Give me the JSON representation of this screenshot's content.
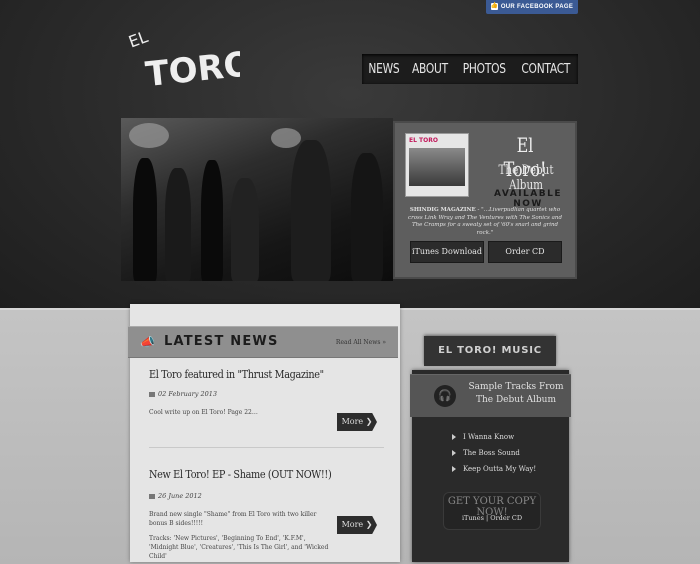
{
  "facebook": {
    "label": "OUR FACEBOOK PAGE"
  },
  "logo": {
    "text_el": "EL",
    "text_main": "TORO!"
  },
  "nav": {
    "items": [
      "NEWS",
      "ABOUT",
      "PHOTOS",
      "CONTACT"
    ]
  },
  "album": {
    "cover_title": "EL TORO",
    "title": "El Toro!",
    "subtitle": "The Debut Album",
    "availability": "AVAILABLE NOW",
    "blurb_source": "SHINDIG MAGAZINE",
    "blurb": "- \"…Liverpudlian quartet who cross Link Wray and The Ventures with The Sonics and The Cramps for a sweaty set of '60's snarl and grind rock.\"",
    "itunes_label": "iTunes Download",
    "order_label": "Order CD"
  },
  "news": {
    "header": "LATEST NEWS",
    "read_all": "Read All News »",
    "posts": [
      {
        "title": "El Toro featured in \"Thrust Magazine\"",
        "date": "02 February 2013",
        "body": "Cool write up on El Toro! Page 22…",
        "more": "More ❯"
      },
      {
        "title": "New El Toro! EP - Shame (OUT NOW!!)",
        "date": "26 June 2012",
        "body": "Brand new single \"Shame\" from El Toro with two killer bonus B sides!!!!!",
        "body2": "Tracks: 'New Pictures', 'Beginning To End', 'K.F.M', 'Midnight Blue', 'Creatures', 'This Is The Girl', and 'Wicked Child'",
        "more": "More ❯"
      }
    ]
  },
  "music": {
    "tab": "EL TORO! MUSIC",
    "banner_line1": "Sample Tracks From",
    "banner_line2": "The Debut Album",
    "tracks": [
      "I Wanna Know",
      "The Boss Sound",
      "Keep Outta My Way!"
    ],
    "get_copy": "GET YOUR COPY NOW!",
    "get_copy_links": "iTunes | Order CD"
  }
}
